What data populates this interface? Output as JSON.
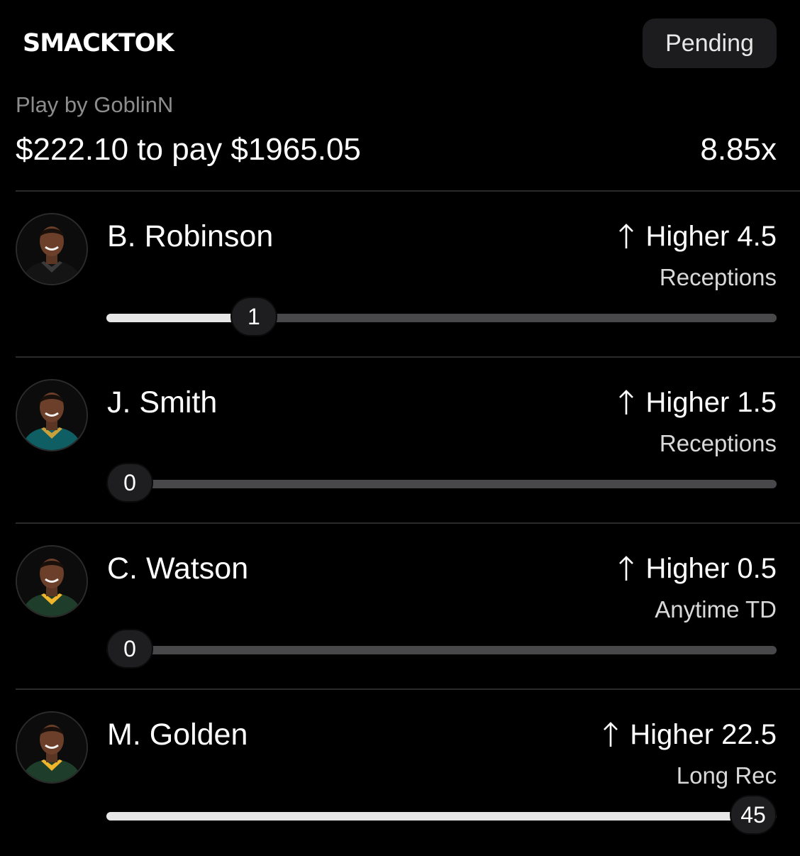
{
  "header": {
    "logo": "SMACKTOK",
    "status": "Pending"
  },
  "play": {
    "by_label": "Play by GoblinN",
    "wager": "$222.10 to pay $1965.05",
    "multiplier": "8.85x"
  },
  "picks": [
    {
      "player": "B. Robinson",
      "direction_icon": "arrow-up-icon",
      "line": "Higher 4.5",
      "stat": "Receptions",
      "current": "1",
      "progress": 0.22,
      "avatar_jersey_color": "#141414",
      "avatar_trim_color": "#3a3a3a"
    },
    {
      "player": "J. Smith",
      "direction_icon": "arrow-up-icon",
      "line": "Higher 1.5",
      "stat": "Receptions",
      "current": "0",
      "progress": 0.0,
      "avatar_jersey_color": "#0f5e63",
      "avatar_trim_color": "#c9a13b"
    },
    {
      "player": "C. Watson",
      "direction_icon": "arrow-up-icon",
      "line": "Higher 0.5",
      "stat": "Anytime TD",
      "current": "0",
      "progress": 0.0,
      "avatar_jersey_color": "#1f3d2b",
      "avatar_trim_color": "#f0b52b"
    },
    {
      "player": "M. Golden",
      "direction_icon": "arrow-up-icon",
      "line": "Higher 22.5",
      "stat": "Long Rec",
      "current": "45",
      "progress": 1.0,
      "avatar_jersey_color": "#1f3d2b",
      "avatar_trim_color": "#f0b52b"
    }
  ],
  "colors": {
    "background": "#000000",
    "badge_bg": "#1c1c1e",
    "track": "#48484a",
    "fill": "#e6e6e6",
    "muted_text": "#8d8d8d"
  }
}
